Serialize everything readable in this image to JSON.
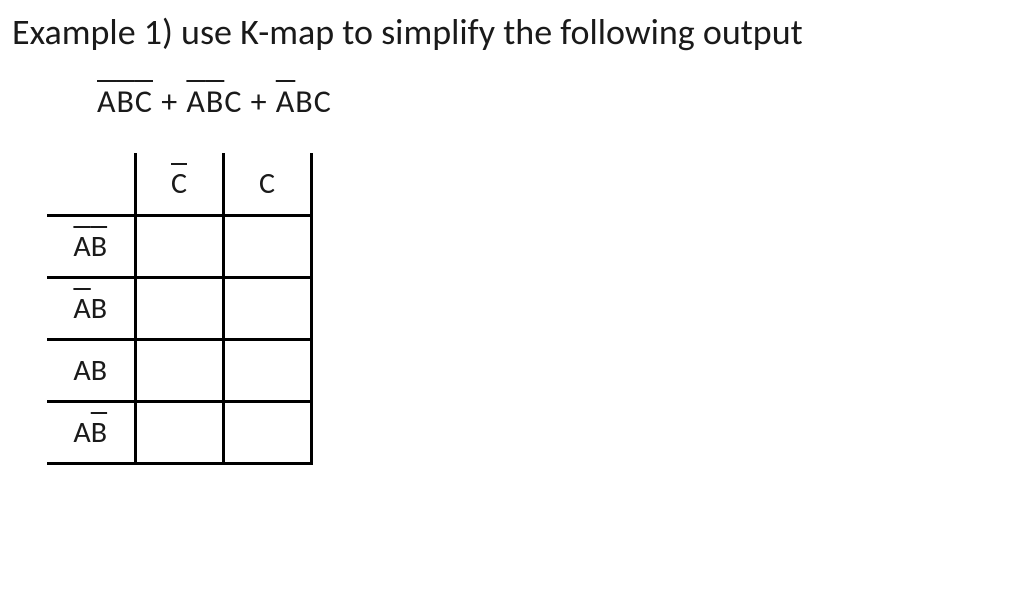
{
  "title": "Example 1) use K-map to simplify the following output",
  "expression": {
    "term1": {
      "a": "A",
      "b": "B",
      "c": "C",
      "abar": true,
      "bbar": true,
      "cbar": true
    },
    "plus1": " + ",
    "term2": {
      "a": "A",
      "b": "B",
      "c": "C",
      "abar": true,
      "bbar": true,
      "cbar": false
    },
    "plus2": " + ",
    "term3": {
      "a": "A",
      "b": "B",
      "c": "C",
      "abar": true,
      "bbar": false,
      "cbar": false
    }
  },
  "kmap": {
    "colHeaders": {
      "cbar": "C",
      "c": "C"
    },
    "rowLabels": {
      "r0_a": "A",
      "r0_b": "B",
      "r1_a": "A",
      "r1_b": "B",
      "r2_a": "A",
      "r2_b": "B",
      "r3_a": "A",
      "r3_b": "B"
    },
    "cells": {
      "r0c0": "",
      "r0c1": "",
      "r1c0": "",
      "r1c1": "",
      "r2c0": "",
      "r2c1": "",
      "r3c0": "",
      "r3c1": ""
    }
  }
}
